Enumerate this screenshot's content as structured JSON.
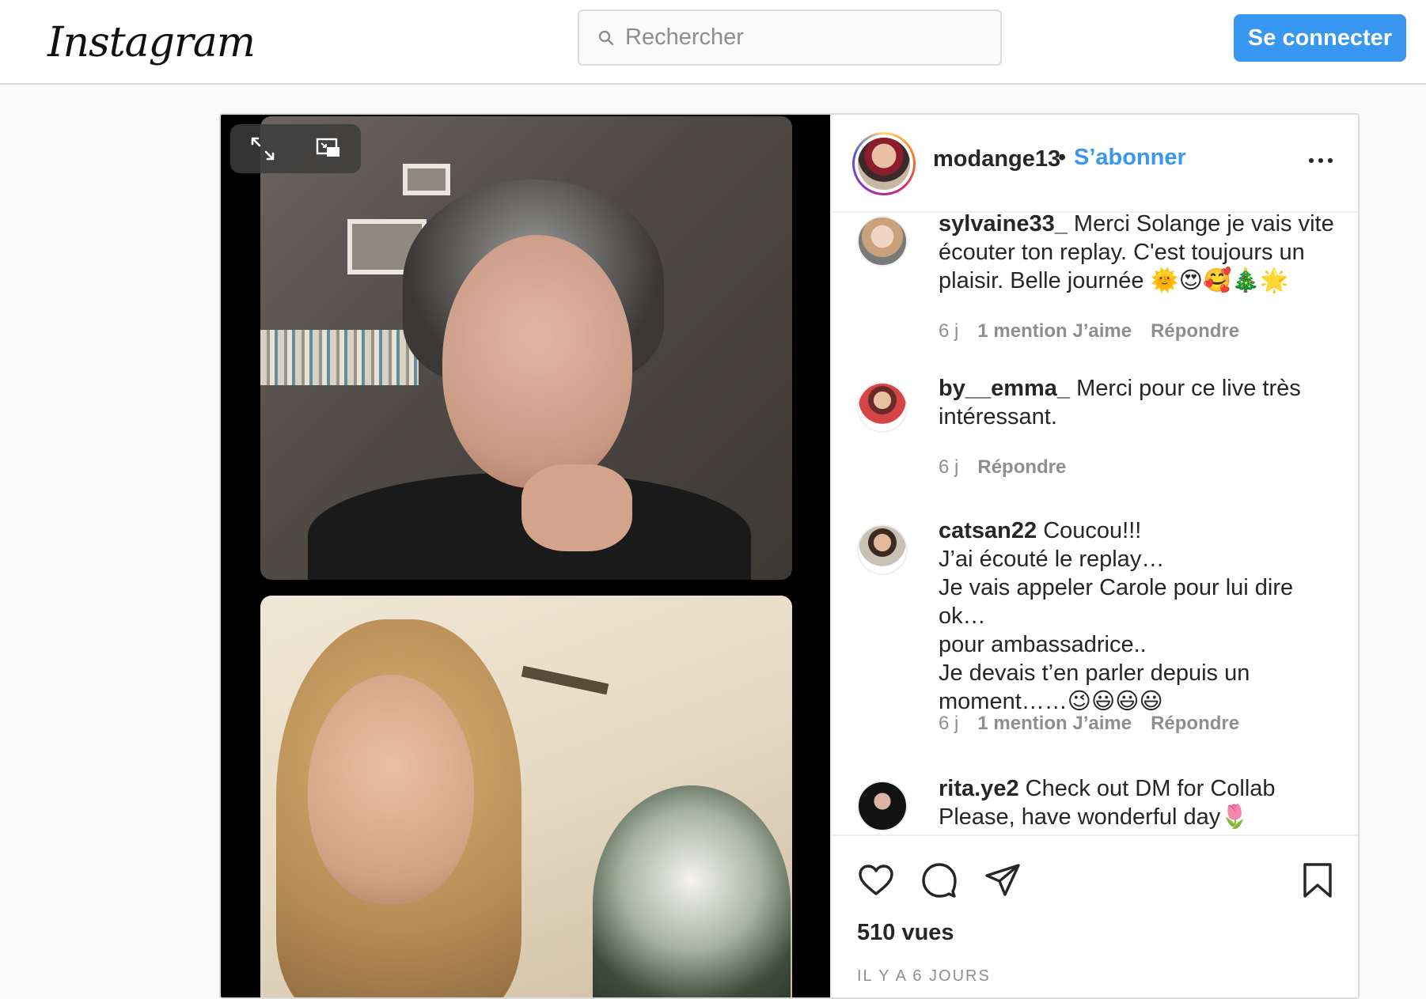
{
  "nav": {
    "logo_text": "Instagram",
    "search_placeholder": "Rechercher",
    "login_label": "Se connecter"
  },
  "post": {
    "author": "modange13",
    "separator": "•",
    "follow_label": "S’abonner",
    "comments": [
      {
        "user": "sylvaine33_",
        "text": "Merci Solange je vais vite écouter ton replay. C'est toujours un plaisir. Belle journée 🌞😍🥰🎄🌟",
        "time": "6 j",
        "likes": "1 mention J’aime",
        "reply": "Répondre"
      },
      {
        "user": "by__emma_",
        "text": "Merci pour ce live très intéressant.",
        "time": "6 j",
        "likes": "",
        "reply": "Répondre"
      },
      {
        "user": "catsan22",
        "text": "Coucou!!!\nJ’ai écouté le replay…\nJe vais appeler Carole pour lui dire ok…\npour ambassadrice..\nJe devais t’en parler depuis un\nmoment……😉😃😃😃",
        "time": "6 j",
        "likes": "1 mention J’aime",
        "reply": "Répondre"
      },
      {
        "user": "rita.ye2",
        "text": "Check out DM for Collab\nPlease, have wonderful day🌷",
        "time": "",
        "likes": "",
        "reply": ""
      }
    ],
    "views": "510 vues",
    "date": "IL Y A 6 JOURS"
  },
  "icons": [
    "search-icon",
    "expand-icon",
    "picture-in-picture-icon",
    "more-icon",
    "heart-icon",
    "comment-icon",
    "share-icon",
    "bookmark-icon"
  ],
  "colors": {
    "accent": "#3897f0",
    "border": "#dbdbdb",
    "muted": "#8e8e8e"
  }
}
